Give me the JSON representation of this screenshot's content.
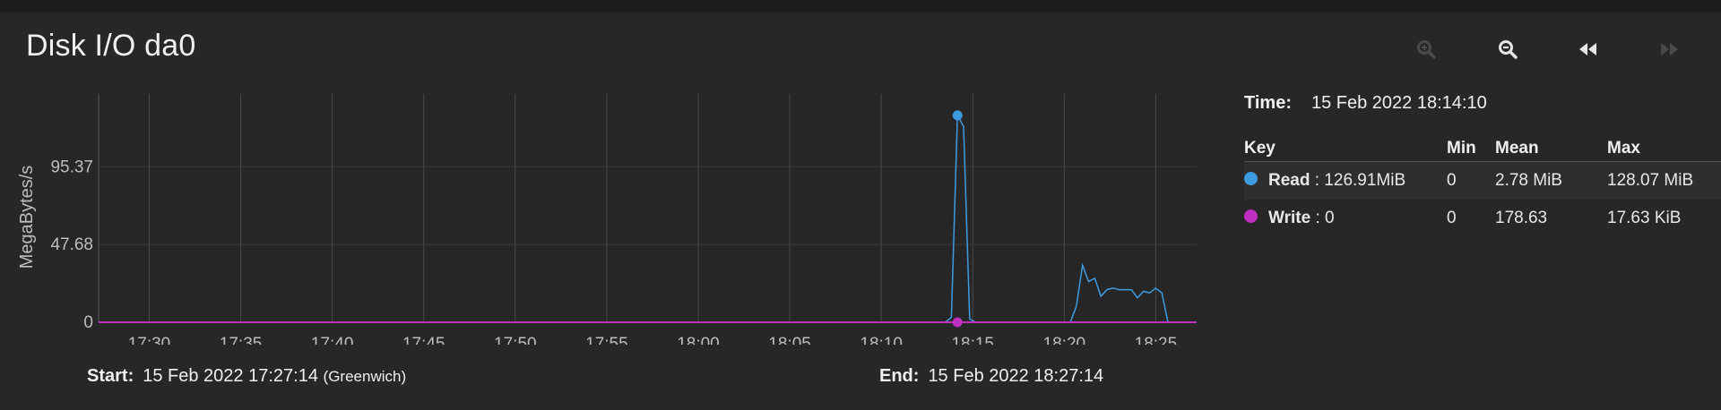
{
  "title": "Disk I/O da0",
  "toolbar": {
    "buttons": [
      {
        "name": "zoom-in-icon",
        "enabled": false
      },
      {
        "name": "zoom-out-icon",
        "enabled": true
      },
      {
        "name": "rewind-icon",
        "enabled": true
      },
      {
        "name": "fast-forward-icon",
        "enabled": false
      }
    ]
  },
  "time": {
    "label": "Time:",
    "value": "15 Feb 2022 18:14:10"
  },
  "legend": {
    "headers": {
      "key": "Key",
      "min": "Min",
      "mean": "Mean",
      "max": "Max"
    },
    "rows": [
      {
        "name": "Read",
        "current": ": 126.91MiB",
        "min": "0",
        "mean": "2.78 MiB",
        "max": "128.07 MiB",
        "color": "#3d9be0"
      },
      {
        "name": "Write",
        "current": ": 0",
        "min": "0",
        "mean": "178.63",
        "max": "17.63 KiB",
        "color": "#c02fc0"
      }
    ]
  },
  "footer": {
    "start_label": "Start:",
    "start_value": "15 Feb 2022 17:27:14",
    "start_tz": "(Greenwich)",
    "end_label": "End:",
    "end_value": "15 Feb 2022 18:27:14"
  },
  "chart_data": {
    "type": "line",
    "ylabel": "MegaBytes/s",
    "yticks": [
      0,
      47.68,
      95.37
    ],
    "ytick_labels": [
      "0",
      "47.68",
      "95.37"
    ],
    "ylim": [
      0,
      140
    ],
    "xlim": [
      "17:27:14",
      "18:27:14"
    ],
    "xticks": [
      "17:30",
      "17:35",
      "17:40",
      "17:45",
      "17:50",
      "17:55",
      "18:00",
      "18:05",
      "18:10",
      "18:15",
      "18:20",
      "18:25"
    ],
    "grid": true,
    "highlight_time": "18:14:10",
    "series": [
      {
        "name": "Read",
        "color": "#3d9be0",
        "points": [
          [
            "17:27:14",
            0
          ],
          [
            "18:13:30",
            0
          ],
          [
            "18:13:50",
            3
          ],
          [
            "18:14:10",
            126.91
          ],
          [
            "18:14:30",
            120
          ],
          [
            "18:14:50",
            2
          ],
          [
            "18:15:10",
            0
          ],
          [
            "18:20:20",
            0
          ],
          [
            "18:20:40",
            10
          ],
          [
            "18:21:00",
            35
          ],
          [
            "18:21:20",
            25
          ],
          [
            "18:21:40",
            27
          ],
          [
            "18:22:00",
            16
          ],
          [
            "18:22:20",
            20
          ],
          [
            "18:22:40",
            21
          ],
          [
            "18:23:00",
            20
          ],
          [
            "18:23:20",
            20
          ],
          [
            "18:23:40",
            20
          ],
          [
            "18:24:00",
            15
          ],
          [
            "18:24:20",
            19
          ],
          [
            "18:24:40",
            18
          ],
          [
            "18:25:00",
            21
          ],
          [
            "18:25:20",
            18
          ],
          [
            "18:25:40",
            0
          ],
          [
            "18:27:14",
            0
          ]
        ]
      },
      {
        "name": "Write",
        "color": "#c02fc0",
        "points": [
          [
            "17:27:14",
            0
          ],
          [
            "18:27:14",
            0
          ]
        ]
      }
    ]
  }
}
